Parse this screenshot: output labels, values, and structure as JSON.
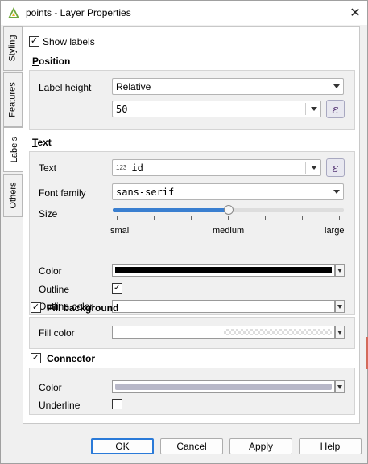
{
  "window": {
    "title": "points - Layer Properties"
  },
  "tabs": [
    {
      "label": "Styling"
    },
    {
      "label": "Features"
    },
    {
      "label": "Labels"
    },
    {
      "label": "Others"
    }
  ],
  "show_labels": {
    "label": "Show labels",
    "checked": "✓"
  },
  "position": {
    "title": "Position",
    "label_height_label": "Label height",
    "label_height_value": "Relative",
    "size_value": "50"
  },
  "text": {
    "title": "Text",
    "text_label": "Text",
    "text_type_badge": "123",
    "text_value": "id",
    "font_family_label": "Font family",
    "font_family_value": "sans-serif",
    "size_label": "Size",
    "size_fraction": 0.5,
    "size_small": "small",
    "size_medium": "medium",
    "size_large": "large",
    "color_label": "Color",
    "color_value": "#000000",
    "outline_label": "Outline",
    "outline_checked": "✓",
    "outline_color_label": "Outline color",
    "outline_color_value": "#ffffff"
  },
  "fill_background": {
    "title": "Fill background",
    "checked": "✓",
    "fill_color_label": "Fill color",
    "fill_color_value": "#ffffff"
  },
  "connector": {
    "title": "Connector",
    "checked": "✓",
    "color_label": "Color",
    "color_value": "#b8b8c8",
    "underline_label": "Underline"
  },
  "expression_icon": "ε",
  "buttons": {
    "ok": "OK",
    "cancel": "Cancel",
    "apply": "Apply",
    "help": "Help"
  }
}
